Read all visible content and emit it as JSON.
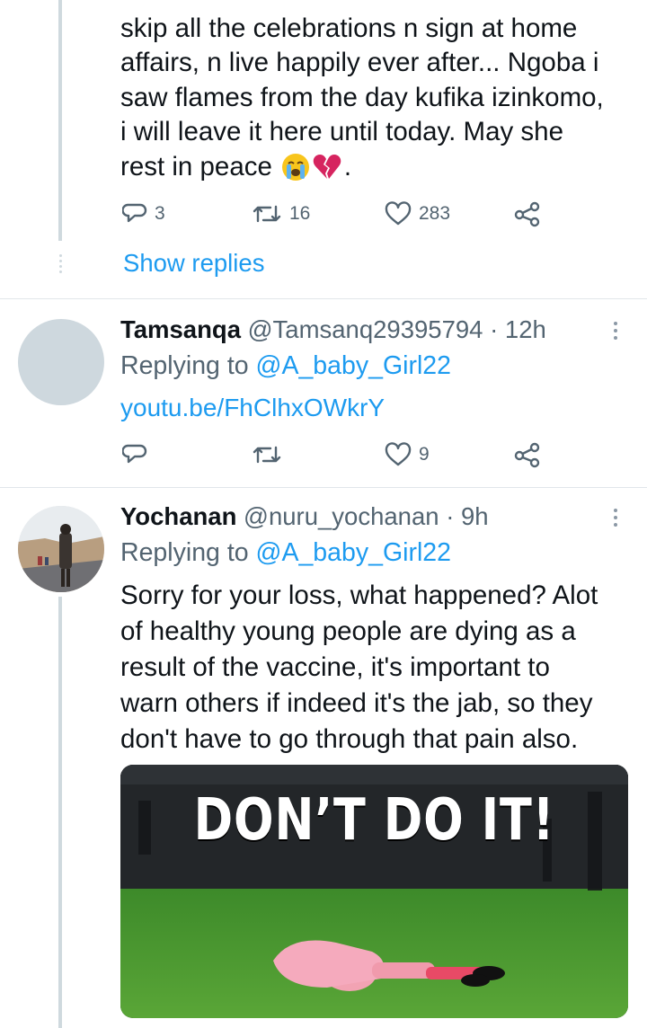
{
  "tweet1": {
    "text_lines": [
      "skip all the celebrations n sign at home",
      "affairs, n live happily ever after... Ngoba i",
      "saw flames from the day kufika izinkomo,",
      "i will leave it here until today. May she",
      "rest in peace"
    ],
    "text_tail": ".",
    "emoji_names": [
      "loudly-crying-face",
      "broken-heart"
    ],
    "replies": "3",
    "retweets": "16",
    "likes": "283",
    "show_replies": "Show replies"
  },
  "tweet2": {
    "name": "Tamsanqa",
    "handle": "@Tamsanq29395794",
    "time": "· 12h",
    "replying_prefix": "Replying to",
    "replying_to": "@A_baby_Girl22",
    "link": "youtu.be/FhClhxOWkrY",
    "likes": "9"
  },
  "tweet3": {
    "name": "Yochanan",
    "handle": "@nuru_yochanan",
    "time": "· 9h",
    "replying_prefix": "Replying to",
    "replying_to": "@A_baby_Girl22",
    "text_lines": [
      "Sorry for your loss, what happened? Alot",
      "of healthy young people are dying as a",
      "result of the vaccine, it's important to",
      "warn others if indeed it's the jab, so they",
      "don't have to go through that pain also."
    ],
    "media_caption": "DON’T DO IT!"
  },
  "colors": {
    "accent": "#1d9bf0",
    "muted": "#536471",
    "thread_line": "#cfd9de",
    "grass": "#3f8a2c"
  }
}
